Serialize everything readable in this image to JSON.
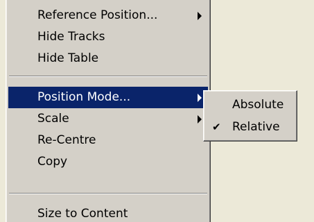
{
  "menu": {
    "items": [
      {
        "label": "Reference Position...",
        "submenu": true
      },
      {
        "label": "Hide Tracks",
        "submenu": false
      },
      {
        "label": "Hide Table",
        "submenu": false
      },
      {
        "label": "Position Mode...",
        "submenu": true,
        "highlighted": true
      },
      {
        "label": "Scale",
        "submenu": true
      },
      {
        "label": "Re-Centre",
        "submenu": false
      },
      {
        "label": "Copy",
        "submenu": false
      },
      {
        "label": "Size to Content",
        "submenu": false
      }
    ]
  },
  "submenu": {
    "items": [
      {
        "label": "Absolute",
        "checked": false
      },
      {
        "label": "Relative",
        "checked": true,
        "check_glyph": "✔"
      }
    ]
  },
  "colors": {
    "menu_bg": "#D4D0C8",
    "highlight_bg": "#0A246A",
    "desktop_bg": "#ECE9D8"
  }
}
